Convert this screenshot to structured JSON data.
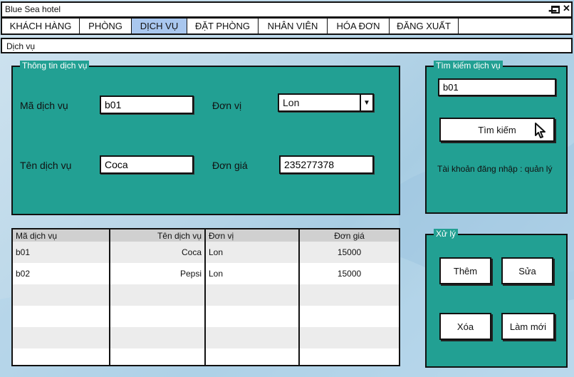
{
  "window": {
    "title": "Blue Sea hotel",
    "minimize": "▁",
    "close": "✕"
  },
  "menu": [
    {
      "label": "KHÁCH HÀNG",
      "active": false
    },
    {
      "label": "PHÒNG",
      "active": false
    },
    {
      "label": "DỊCH VỤ",
      "active": true
    },
    {
      "label": "ĐẶT PHÒNG",
      "active": false
    },
    {
      "label": "NHÂN VIÊN",
      "active": false
    },
    {
      "label": "HÓA ĐƠN",
      "active": false
    },
    {
      "label": "ĐĂNG XUẤT",
      "active": false
    }
  ],
  "breadcrumb": "Dịch vụ",
  "info": {
    "legend": "Thông tin dịch vụ",
    "service_code_label": "Mã dịch vụ",
    "service_code_value": "b01",
    "unit_label": "Đơn vị",
    "unit_value": "Lon",
    "service_name_label": "Tên dịch vụ",
    "service_name_value": "Coca",
    "price_label": "Đơn giá",
    "price_value": "235277378"
  },
  "search": {
    "legend": "Tìm kiếm dịch vụ",
    "value": "b01",
    "button": "Tìm kiếm",
    "login_info": "Tài khoản đăng nhập : quản lý"
  },
  "actions": {
    "legend": "Xử lý",
    "add": "Thêm",
    "edit": "Sửa",
    "delete": "Xóa",
    "refresh": "Làm mới"
  },
  "table": {
    "headers": [
      "Mã dịch vụ",
      "Tên dịch vụ",
      "Đơn vị",
      "Đơn giá"
    ],
    "rows": [
      [
        "b01",
        "Coca",
        "Lon",
        "15000"
      ],
      [
        "b02",
        "Pepsi",
        "Lon",
        "15000"
      ],
      [
        "",
        "",
        "",
        ""
      ],
      [
        "",
        "",
        "",
        ""
      ],
      [
        "",
        "",
        "",
        ""
      ],
      [
        "",
        "",
        "",
        ""
      ]
    ]
  },
  "colors": {
    "panel": "#22a093",
    "active_tab": "#a9c7ef",
    "header_bg": "#d0d0d0"
  },
  "icons": [
    "minimize-icon",
    "maximize-icon",
    "close-icon",
    "dropdown-arrow-icon",
    "cursor-icon"
  ]
}
